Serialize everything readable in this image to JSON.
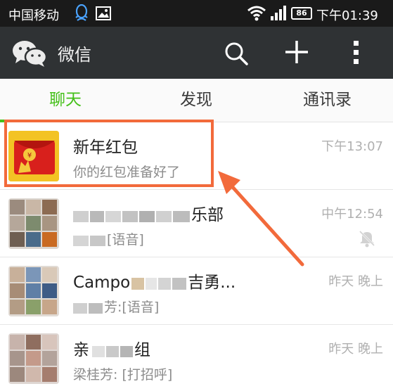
{
  "status_bar": {
    "carrier": "中国移动",
    "battery": "86",
    "time": "下午01:39",
    "icons": [
      "qq-icon",
      "image-icon",
      "wifi-icon",
      "signal-icon",
      "battery-icon"
    ]
  },
  "app_bar": {
    "title": "微信",
    "icons": [
      "wechat-logo-icon",
      "search-icon",
      "plus-icon",
      "more-icon"
    ]
  },
  "tabs": [
    {
      "label": "聊天",
      "active": true
    },
    {
      "label": "发现",
      "active": false
    },
    {
      "label": "通讯录",
      "active": false
    }
  ],
  "chats": [
    {
      "name": "新年红包",
      "preview": "你的红包准备好了",
      "time": "下午13:07"
    },
    {
      "name_suffix": "乐部",
      "preview_suffix": "[语音]",
      "time": "中午12:54",
      "muted": true
    },
    {
      "name_prefix": "Campo",
      "name_suffix": "吉勇...",
      "preview_suffix": "芳:[语音]",
      "time": "昨天 晚上"
    },
    {
      "name_prefix": "亲",
      "name_suffix": "组",
      "preview": "梁桂芳: [打招呼]",
      "time": "昨天 晚上"
    }
  ],
  "colors": {
    "accent": "#45c01a",
    "highlight": "#f26a3b",
    "appbar": "#2f3234"
  }
}
